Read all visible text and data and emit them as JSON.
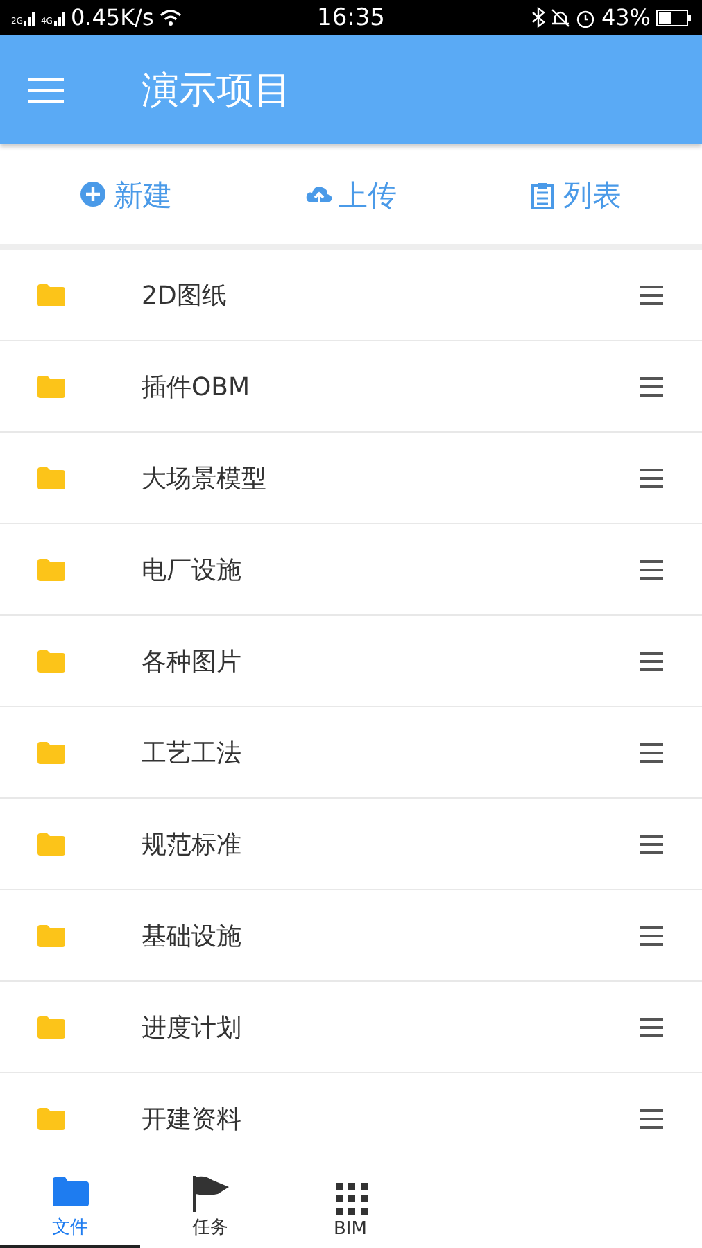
{
  "status_bar": {
    "signal_1": "2G",
    "signal_2": "4G",
    "speed": "0.45K/s",
    "time": "16:35",
    "battery": "43%"
  },
  "app_bar": {
    "title": "演示项目"
  },
  "actions": [
    {
      "kind": "new",
      "label": "新建"
    },
    {
      "kind": "upload",
      "label": "上传"
    },
    {
      "kind": "list",
      "label": "列表"
    }
  ],
  "folders": [
    {
      "name": "2D图纸"
    },
    {
      "name": "插件OBM"
    },
    {
      "name": "大场景模型"
    },
    {
      "name": "电厂设施"
    },
    {
      "name": "各种图片"
    },
    {
      "name": "工艺工法"
    },
    {
      "name": "规范标准"
    },
    {
      "name": "基础设施"
    },
    {
      "name": "进度计划"
    },
    {
      "name": "开建资料"
    }
  ],
  "bottom_nav": [
    {
      "kind": "folder",
      "label": "文件",
      "selected": true
    },
    {
      "kind": "flag",
      "label": "任务",
      "selected": false
    },
    {
      "kind": "grid",
      "label": "BIM",
      "selected": false
    }
  ]
}
